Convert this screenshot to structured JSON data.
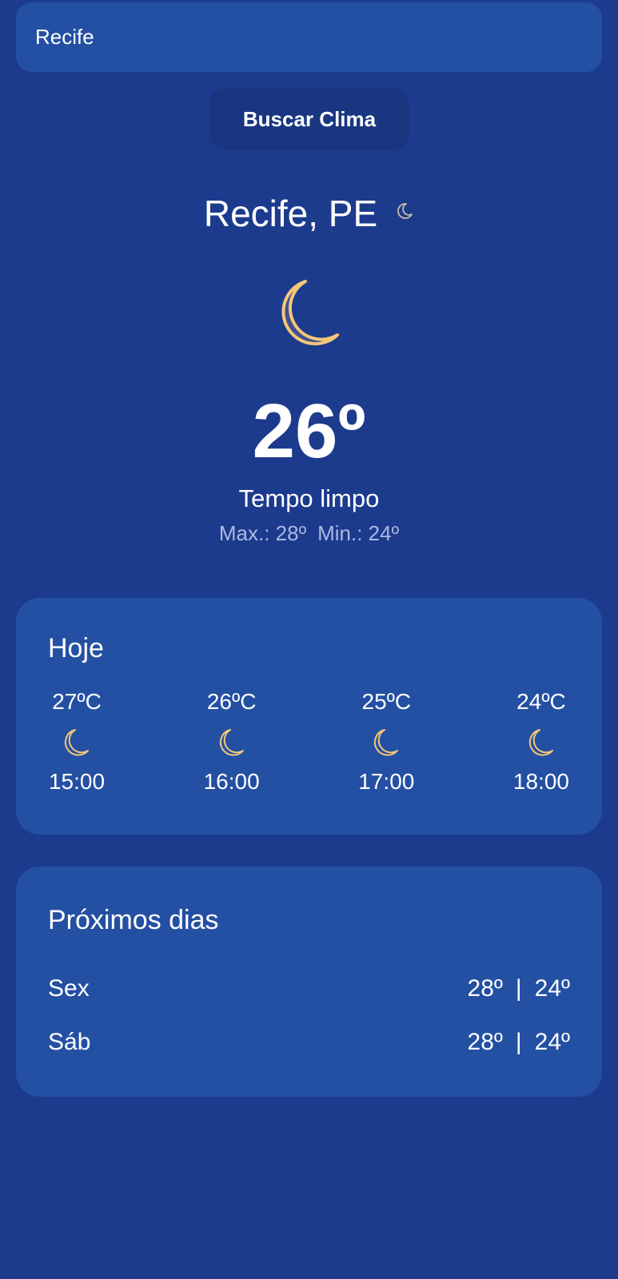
{
  "search": {
    "value": "Recife",
    "button_label": "Buscar Clima"
  },
  "current": {
    "location": "Recife, PE",
    "temperature": "26º",
    "condition": "Tempo limpo",
    "max": "Max.: 28º",
    "min": "Min.: 24º",
    "icon": "moon-icon"
  },
  "today": {
    "title": "Hoje",
    "hours": [
      {
        "temp": "27ºC",
        "time": "15:00",
        "icon": "moon-icon"
      },
      {
        "temp": "26ºC",
        "time": "16:00",
        "icon": "moon-icon"
      },
      {
        "temp": "25ºC",
        "time": "17:00",
        "icon": "moon-icon"
      },
      {
        "temp": "24ºC",
        "time": "18:00",
        "icon": "moon-icon"
      }
    ]
  },
  "next_days": {
    "title": "Próximos dias",
    "days": [
      {
        "day": "Sex",
        "max": "28º",
        "separator": "|",
        "min": "24º"
      },
      {
        "day": "Sáb",
        "max": "28º",
        "separator": "|",
        "min": "24º"
      }
    ]
  },
  "colors": {
    "background": "#1d3b8d",
    "card": "#2450a3",
    "button": "#1a3681",
    "moon_stroke": "#f5c877",
    "secondary_text": "#a9b9e2"
  }
}
